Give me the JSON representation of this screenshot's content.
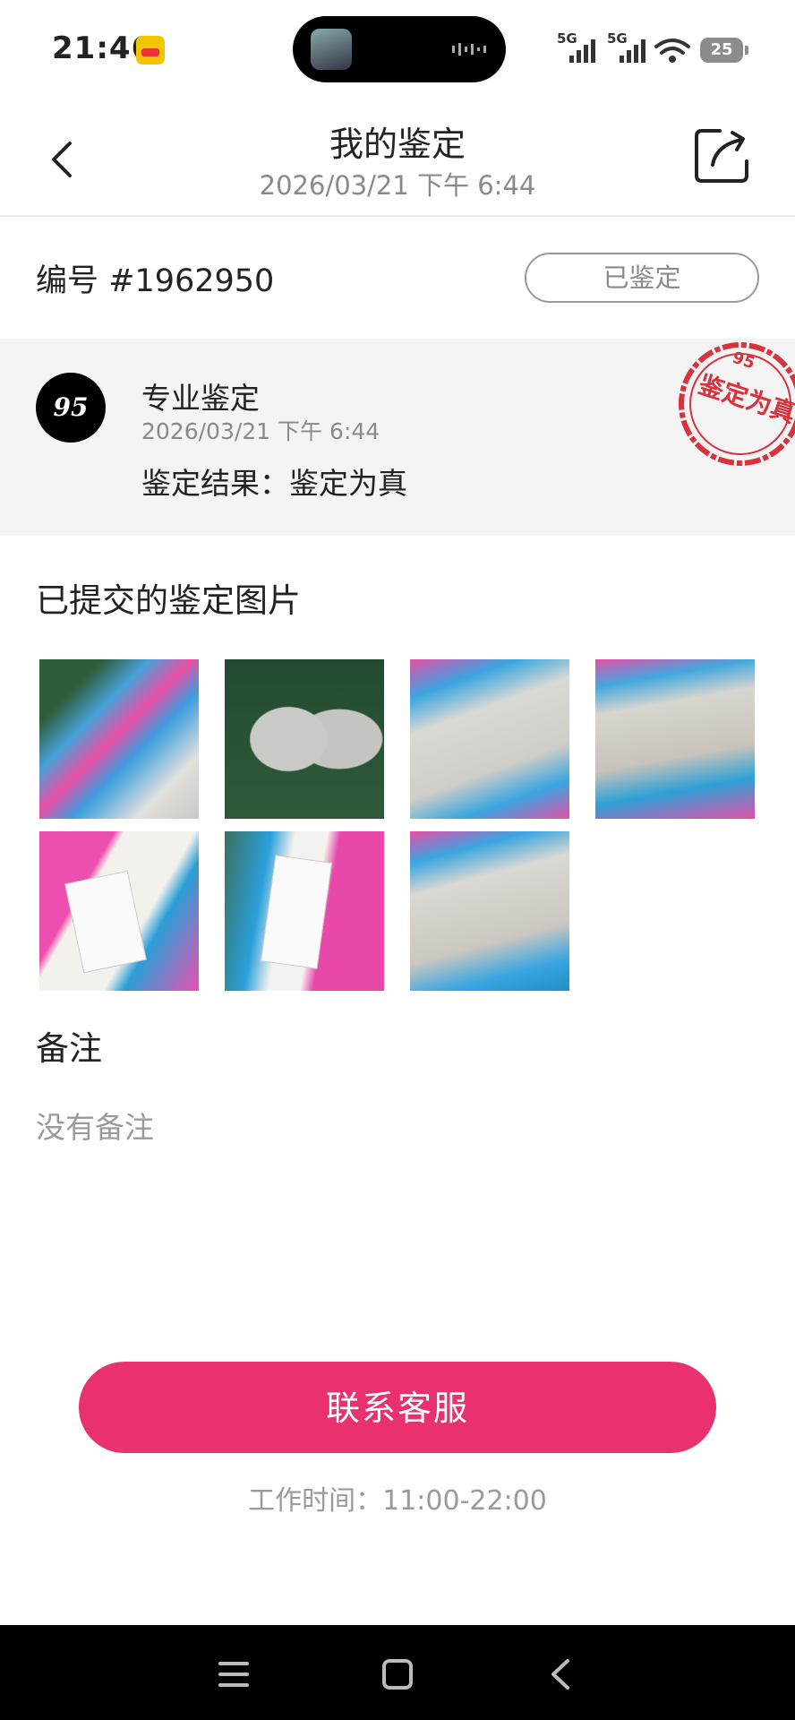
{
  "status_bar": {
    "time": "21:46",
    "network": [
      "5G",
      "5G"
    ],
    "battery": "25",
    "icons": [
      "app-badge-icon",
      "signal-icon",
      "wifi-icon",
      "battery-icon"
    ]
  },
  "header": {
    "title": "我的鉴定",
    "subtitle": "2026/03/21 下午 6:44",
    "icons": [
      "chevron-left-icon",
      "share-icon"
    ]
  },
  "order": {
    "number": "编号 #1962950",
    "status": "已鉴定"
  },
  "result_card": {
    "logo_text": "95",
    "service_name": "专业鉴定",
    "service_time": "2026/03/21 下午 6:44",
    "result": "鉴定结果：鉴定为真",
    "stamp_text": "鉴定为真",
    "stamp_mark": "95"
  },
  "images": {
    "title": "已提交的鉴定图片",
    "count": 7
  },
  "remarks": {
    "title": "备注",
    "text": "没有备注"
  },
  "contact": {
    "button": "联系客服",
    "hours": "工作时间：11:00-22:00"
  },
  "colors": {
    "accent": "#e8316e",
    "stamp": "#d8333c",
    "muted": "#8a8a8a"
  },
  "nav": [
    "menu-icon",
    "home-square-icon",
    "back-triangle-icon"
  ]
}
